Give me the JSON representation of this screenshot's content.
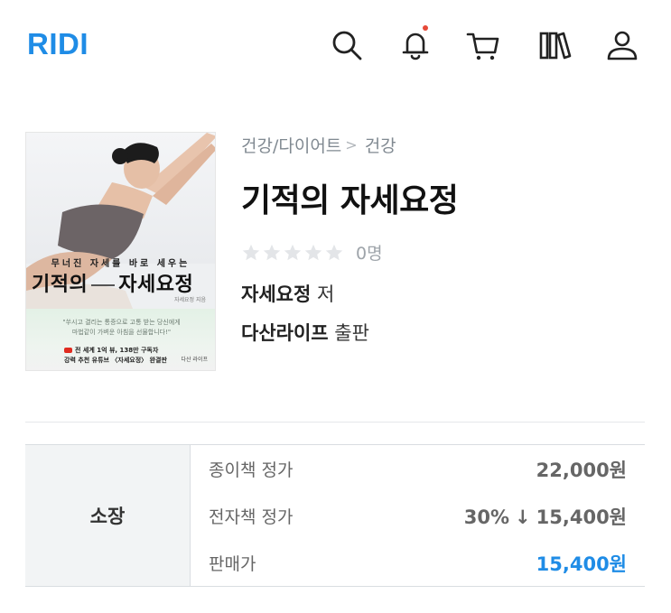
{
  "app": {
    "logo": "RIDI"
  },
  "header": {
    "icons": [
      "search-icon",
      "bell-icon",
      "cart-icon",
      "library-icon",
      "user-icon"
    ],
    "notification_dot_color": "#e64938"
  },
  "book": {
    "cover": {
      "tagline": "무너진 자세를 바로 세우는",
      "title_left": "기적의",
      "title_right": "자세요정",
      "author_small": "자세요정 지음",
      "quote_line1": "\"쑤시고 결리는 통증으로 고통 받는 당신에게",
      "quote_line2": "마법같이 가벼운 아침을 선물합니다!\"",
      "badge_line1": "전 세계 1억 뷰, 138만 구독자",
      "badge_line2": "강력 추천 유튜브 〈자세요정〉 완결판",
      "publisher_small": "다산 라이프"
    },
    "breadcrumb": [
      "건강/다이어트",
      "건강"
    ],
    "breadcrumb_separator": ">",
    "title": "기적의 자세요정",
    "rating": {
      "stars": 0,
      "max_stars": 5,
      "count_text": "0명"
    },
    "author": {
      "name": "자세요정",
      "role": "저"
    },
    "publisher": {
      "name": "다산라이프",
      "role": "출판"
    }
  },
  "pricing": {
    "section_label": "소장",
    "rows": [
      {
        "label": "종이책 정가",
        "value": "22,000원"
      },
      {
        "label": "전자책 정가",
        "discount": "30%",
        "arrow": "↓",
        "value": "15,400원"
      },
      {
        "label": "판매가",
        "value": "15,400원"
      }
    ],
    "accent_color": "#1f8ce6"
  }
}
